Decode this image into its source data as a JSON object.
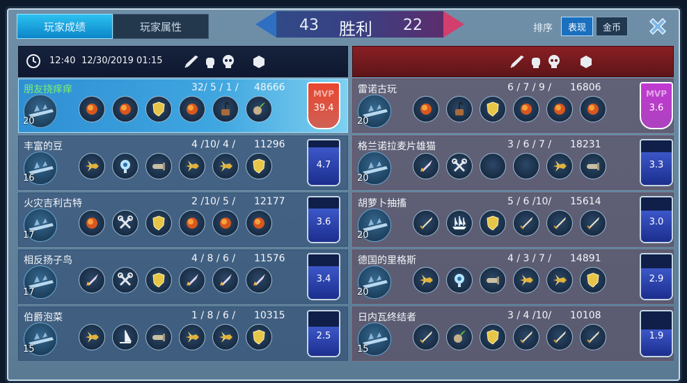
{
  "tabs": {
    "stats": "玩家成绩",
    "attributes": "玩家属性"
  },
  "score": {
    "left": "43",
    "right": "22",
    "result": "胜利"
  },
  "sort": {
    "label": "排序",
    "performance": "表现",
    "gold": "金币"
  },
  "header": {
    "time": "12:40",
    "datetime": "12/30/2019 01:15"
  },
  "colors": {
    "blue_team": "#2f6fc2",
    "red_team": "#d23e6d",
    "mvp_orange": "#e8462f",
    "mvp_purple": "#c03ad0",
    "highlight_name": "#7cf06c"
  },
  "left_team": [
    {
      "name": "朋友挠痒痒",
      "kda": "32/ 5 / 1 /",
      "gold": "48666",
      "level": "20",
      "score": "39.4",
      "mvp": true,
      "highlight": true,
      "items": [
        "fire-orb-icon",
        "fire-orb-icon",
        "shield-icon",
        "fire-orb-icon",
        "pot-icon",
        "leaf-orb-icon"
      ]
    },
    {
      "name": "丰富的豆",
      "kda": "4 /10/ 4 /",
      "gold": "11296",
      "level": "16",
      "score": "4.7",
      "fill": 0.45,
      "items": [
        "jet-icon",
        "radar-icon",
        "torpedo-icon",
        "jet-icon",
        "jet-icon",
        "shield-icon"
      ]
    },
    {
      "name": "火灾吉利古特",
      "kda": "2 /10/ 5 /",
      "gold": "12177",
      "level": "17",
      "score": "3.6",
      "fill": 0.35,
      "items": [
        "fire-orb-icon",
        "wrench-icon",
        "shield-icon",
        "fire-orb-icon",
        "fire-orb-icon",
        "fire-orb-icon"
      ]
    },
    {
      "name": "相反扬子鸟",
      "kda": "4 / 8 / 6 /",
      "gold": "11576",
      "level": "17",
      "score": "3.4",
      "fill": 0.33,
      "items": [
        "rocket-icon",
        "wrench-icon",
        "shield-icon",
        "rocket-icon",
        "rocket-icon",
        "rocket-icon"
      ]
    },
    {
      "name": "伯爵泡菜",
      "kda": "1 / 8 / 6 /",
      "gold": "10315",
      "level": "15",
      "score": "2.5",
      "fill": 0.25,
      "items": [
        "jet-icon",
        "sail-icon",
        "torpedo-icon",
        "jet-icon",
        "jet-icon",
        "shield-icon"
      ]
    }
  ],
  "right_team": [
    {
      "name": "雷诺古玩",
      "kda": "6 / 7 / 9 /",
      "gold": "16806",
      "level": "20",
      "score": "3.6",
      "mvp": true,
      "items": [
        "fire-orb-icon",
        "pot-icon",
        "shield-icon",
        "fire-orb-icon",
        "fire-orb-icon",
        "fire-orb-icon"
      ]
    },
    {
      "name": "格兰诺拉麦片雄猫",
      "kda": "3 / 6 / 7 /",
      "gold": "18231",
      "level": "20",
      "score": "3.3",
      "fill": 0.33,
      "items": [
        "rocket-icon",
        "wrench-icon",
        "empty-icon",
        "empty-icon",
        "jet-icon",
        "torpedo-icon"
      ]
    },
    {
      "name": "胡萝卜抽搐",
      "kda": "5 / 6 /10/",
      "gold": "15614",
      "level": "20",
      "score": "3.0",
      "fill": 0.3,
      "items": [
        "sword-icon",
        "ship-icon",
        "shield-icon",
        "sword-icon",
        "sword-icon",
        "sword-icon"
      ]
    },
    {
      "name": "德国的里格斯",
      "kda": "4 / 3 / 7 /",
      "gold": "14891",
      "level": "20",
      "score": "2.9",
      "fill": 0.29,
      "items": [
        "jet-icon",
        "radar-icon",
        "torpedo-icon",
        "jet-icon",
        "jet-icon",
        "shield-icon"
      ]
    },
    {
      "name": "日内瓦终结者",
      "kda": "3 / 4 /10/",
      "gold": "10108",
      "level": "15",
      "score": "1.9",
      "fill": 0.19,
      "items": [
        "sword-icon",
        "leaf-orb-icon",
        "shield-icon",
        "sword-icon",
        "sword-icon",
        "sword-icon"
      ]
    }
  ],
  "mvp_label": "MVP"
}
